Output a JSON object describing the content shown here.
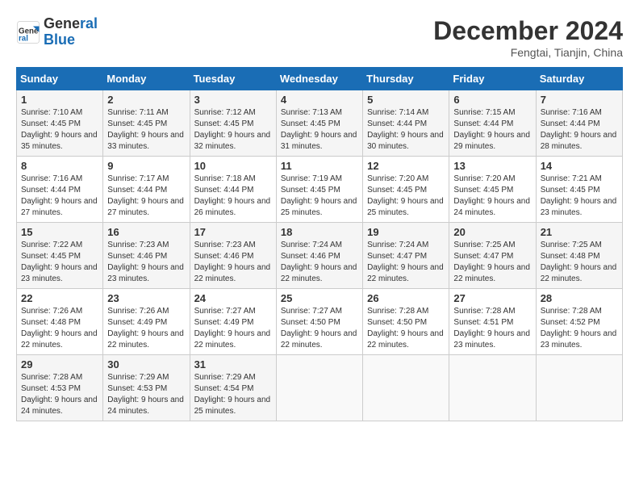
{
  "header": {
    "logo_line1": "General",
    "logo_line2": "Blue",
    "month": "December 2024",
    "location": "Fengtai, Tianjin, China"
  },
  "weekdays": [
    "Sunday",
    "Monday",
    "Tuesday",
    "Wednesday",
    "Thursday",
    "Friday",
    "Saturday"
  ],
  "weeks": [
    [
      {
        "day": "1",
        "sunrise": "7:10 AM",
        "sunset": "4:45 PM",
        "daylight": "9 hours and 35 minutes."
      },
      {
        "day": "2",
        "sunrise": "7:11 AM",
        "sunset": "4:45 PM",
        "daylight": "9 hours and 33 minutes."
      },
      {
        "day": "3",
        "sunrise": "7:12 AM",
        "sunset": "4:45 PM",
        "daylight": "9 hours and 32 minutes."
      },
      {
        "day": "4",
        "sunrise": "7:13 AM",
        "sunset": "4:45 PM",
        "daylight": "9 hours and 31 minutes."
      },
      {
        "day": "5",
        "sunrise": "7:14 AM",
        "sunset": "4:44 PM",
        "daylight": "9 hours and 30 minutes."
      },
      {
        "day": "6",
        "sunrise": "7:15 AM",
        "sunset": "4:44 PM",
        "daylight": "9 hours and 29 minutes."
      },
      {
        "day": "7",
        "sunrise": "7:16 AM",
        "sunset": "4:44 PM",
        "daylight": "9 hours and 28 minutes."
      }
    ],
    [
      {
        "day": "8",
        "sunrise": "7:16 AM",
        "sunset": "4:44 PM",
        "daylight": "9 hours and 27 minutes."
      },
      {
        "day": "9",
        "sunrise": "7:17 AM",
        "sunset": "4:44 PM",
        "daylight": "9 hours and 27 minutes."
      },
      {
        "day": "10",
        "sunrise": "7:18 AM",
        "sunset": "4:44 PM",
        "daylight": "9 hours and 26 minutes."
      },
      {
        "day": "11",
        "sunrise": "7:19 AM",
        "sunset": "4:45 PM",
        "daylight": "9 hours and 25 minutes."
      },
      {
        "day": "12",
        "sunrise": "7:20 AM",
        "sunset": "4:45 PM",
        "daylight": "9 hours and 25 minutes."
      },
      {
        "day": "13",
        "sunrise": "7:20 AM",
        "sunset": "4:45 PM",
        "daylight": "9 hours and 24 minutes."
      },
      {
        "day": "14",
        "sunrise": "7:21 AM",
        "sunset": "4:45 PM",
        "daylight": "9 hours and 23 minutes."
      }
    ],
    [
      {
        "day": "15",
        "sunrise": "7:22 AM",
        "sunset": "4:45 PM",
        "daylight": "9 hours and 23 minutes."
      },
      {
        "day": "16",
        "sunrise": "7:23 AM",
        "sunset": "4:46 PM",
        "daylight": "9 hours and 23 minutes."
      },
      {
        "day": "17",
        "sunrise": "7:23 AM",
        "sunset": "4:46 PM",
        "daylight": "9 hours and 22 minutes."
      },
      {
        "day": "18",
        "sunrise": "7:24 AM",
        "sunset": "4:46 PM",
        "daylight": "9 hours and 22 minutes."
      },
      {
        "day": "19",
        "sunrise": "7:24 AM",
        "sunset": "4:47 PM",
        "daylight": "9 hours and 22 minutes."
      },
      {
        "day": "20",
        "sunrise": "7:25 AM",
        "sunset": "4:47 PM",
        "daylight": "9 hours and 22 minutes."
      },
      {
        "day": "21",
        "sunrise": "7:25 AM",
        "sunset": "4:48 PM",
        "daylight": "9 hours and 22 minutes."
      }
    ],
    [
      {
        "day": "22",
        "sunrise": "7:26 AM",
        "sunset": "4:48 PM",
        "daylight": "9 hours and 22 minutes."
      },
      {
        "day": "23",
        "sunrise": "7:26 AM",
        "sunset": "4:49 PM",
        "daylight": "9 hours and 22 minutes."
      },
      {
        "day": "24",
        "sunrise": "7:27 AM",
        "sunset": "4:49 PM",
        "daylight": "9 hours and 22 minutes."
      },
      {
        "day": "25",
        "sunrise": "7:27 AM",
        "sunset": "4:50 PM",
        "daylight": "9 hours and 22 minutes."
      },
      {
        "day": "26",
        "sunrise": "7:28 AM",
        "sunset": "4:50 PM",
        "daylight": "9 hours and 22 minutes."
      },
      {
        "day": "27",
        "sunrise": "7:28 AM",
        "sunset": "4:51 PM",
        "daylight": "9 hours and 23 minutes."
      },
      {
        "day": "28",
        "sunrise": "7:28 AM",
        "sunset": "4:52 PM",
        "daylight": "9 hours and 23 minutes."
      }
    ],
    [
      {
        "day": "29",
        "sunrise": "7:28 AM",
        "sunset": "4:53 PM",
        "daylight": "9 hours and 24 minutes."
      },
      {
        "day": "30",
        "sunrise": "7:29 AM",
        "sunset": "4:53 PM",
        "daylight": "9 hours and 24 minutes."
      },
      {
        "day": "31",
        "sunrise": "7:29 AM",
        "sunset": "4:54 PM",
        "daylight": "9 hours and 25 minutes."
      },
      null,
      null,
      null,
      null
    ]
  ]
}
